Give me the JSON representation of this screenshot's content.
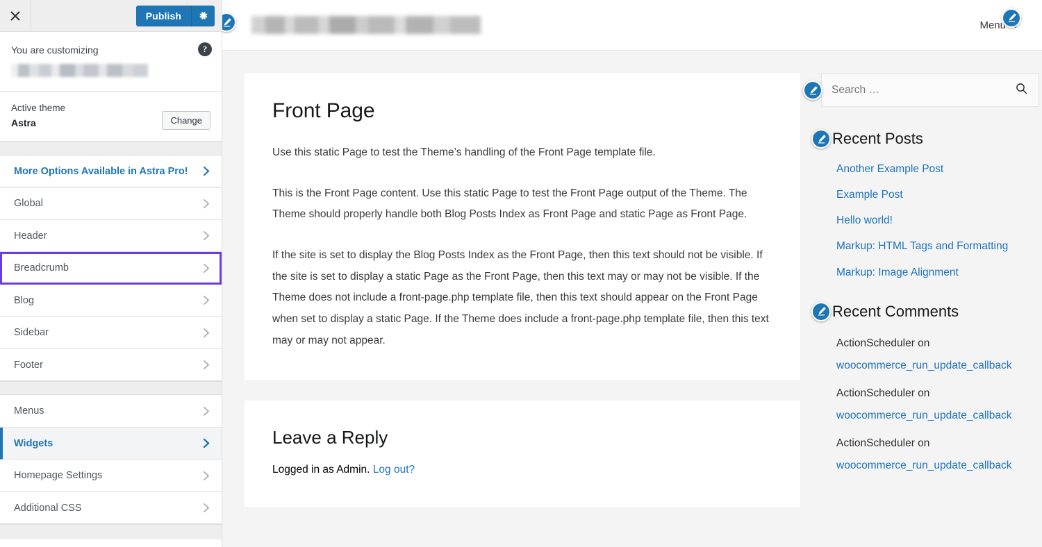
{
  "customizer": {
    "close_icon": "close-icon",
    "publish_label": "Publish",
    "gear_icon": "gear-icon",
    "help_icon": "help-icon",
    "customizing_label": "You are customizing",
    "site_name_redacted": "",
    "active_theme_label": "Active theme",
    "active_theme_name": "Astra",
    "change_label": "Change",
    "accent_color": "#1e76b5",
    "focus_outline_color": "#6a3ce8",
    "panels": [
      {
        "label": "More Options Available in Astra Pro!",
        "style": "pro"
      },
      {
        "label": "Global",
        "style": "normal"
      },
      {
        "label": "Header",
        "style": "normal"
      },
      {
        "label": "Breadcrumb",
        "style": "focused"
      },
      {
        "label": "Blog",
        "style": "normal"
      },
      {
        "label": "Sidebar",
        "style": "normal"
      },
      {
        "label": "Footer",
        "style": "normal"
      }
    ],
    "panels_group2": [
      {
        "label": "Menus",
        "style": "normal"
      },
      {
        "label": "Widgets",
        "style": "active"
      },
      {
        "label": "Homepage Settings",
        "style": "normal"
      },
      {
        "label": "Additional CSS",
        "style": "normal"
      }
    ]
  },
  "preview": {
    "header": {
      "site_title_redacted": "",
      "menu_label": "Menu",
      "chevron_icon": "chevron-down-icon",
      "edit_icon": "edit-pencil-icon"
    },
    "page": {
      "title": "Front Page",
      "paragraphs": [
        "Use this static Page to test the Theme’s handling of the Front Page template file.",
        "This is the Front Page content. Use this static Page to test the Front Page output of the Theme. The Theme should properly handle both Blog Posts Index as Front Page and static Page as Front Page.",
        "If the site is set to display the Blog Posts Index as the Front Page, then this text should not be visible. If the site is set to display a static Page as the Front Page, then this text may or may not be visible. If the Theme does not include a front-page.php template file, then this text should appear on the Front Page when set to display a static Page. If the Theme does include a front-page.php template file, then this text may or may not appear."
      ]
    },
    "comments": {
      "title": "Leave a Reply",
      "logged_in_prefix": "Logged in as Admin.",
      "logout_label": "Log out?"
    },
    "sidebar": {
      "search": {
        "placeholder": "Search …",
        "value": "",
        "icon": "search-icon"
      },
      "recent_posts": {
        "title": "Recent Posts",
        "items": [
          "Another Example Post",
          "Example Post",
          "Hello world!",
          "Markup: HTML Tags and Formatting",
          "Markup: Image Alignment"
        ]
      },
      "recent_comments": {
        "title": "Recent Comments",
        "items": [
          {
            "author": "ActionScheduler on",
            "target": "woocommerce_run_update_callback"
          },
          {
            "author": "ActionScheduler on",
            "target": "woocommerce_run_update_callback"
          },
          {
            "author": "ActionScheduler on",
            "target": "woocommerce_run_update_callback"
          }
        ]
      }
    }
  }
}
